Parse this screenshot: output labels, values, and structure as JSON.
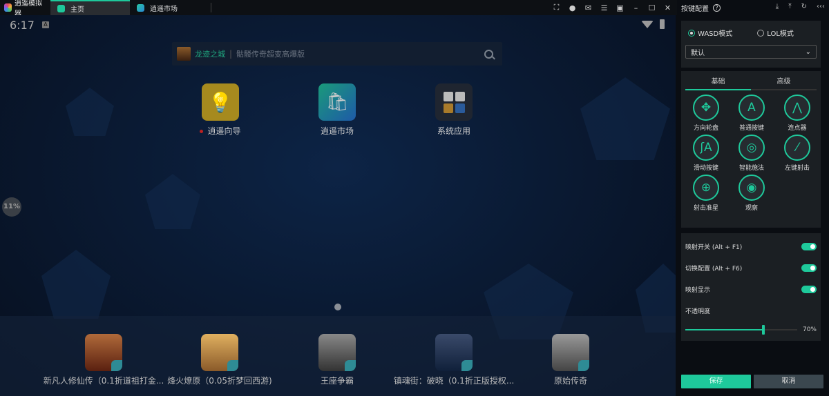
{
  "titlebar": {
    "app_name": "逍遥模拟器",
    "tabs": [
      {
        "label": "主页",
        "active": true
      },
      {
        "label": "逍遥市场",
        "active": false
      }
    ]
  },
  "android": {
    "time": "6:17",
    "status_badge": "A",
    "loading_percent": "11%",
    "search": {
      "featured": "龙迹之城",
      "hint": "骷髅传奇超变高爆版"
    },
    "apps": [
      {
        "label": "逍遥向导",
        "has_dot": true
      },
      {
        "label": "逍遥市场"
      },
      {
        "label": "系统应用"
      }
    ],
    "dock_games": [
      "新凡人修仙传（0.1折道祖打金...",
      "烽火燎原（0.05折梦回西游)",
      "王座争霸",
      "镇魂街：破晓（0.1折正版授权...",
      "原始传奇"
    ]
  },
  "panel": {
    "title": "按键配置",
    "help": "?",
    "modes": [
      {
        "label": "WASD模式",
        "selected": true
      },
      {
        "label": "LOL模式",
        "selected": false
      }
    ],
    "profile": "默认",
    "tabs": [
      {
        "label": "基础",
        "active": true
      },
      {
        "label": "高级",
        "active": false
      }
    ],
    "keys": [
      {
        "label": "方向轮盘",
        "glyph": "✥"
      },
      {
        "label": "普通按键",
        "glyph": "A"
      },
      {
        "label": "连点器",
        "glyph": "⋀"
      },
      {
        "label": "滑动按键",
        "glyph": "ʃA"
      },
      {
        "label": "智能施法",
        "glyph": "◎"
      },
      {
        "label": "左键射击",
        "glyph": "⁄"
      },
      {
        "label": "射击准星",
        "glyph": "⊕"
      },
      {
        "label": "观察",
        "glyph": "◉"
      }
    ],
    "toggles": [
      {
        "label": "映射开关 (Alt + F1)",
        "on": true
      },
      {
        "label": "切换配置 (Alt + F6)",
        "on": true
      },
      {
        "label": "映射显示",
        "on": true
      }
    ],
    "opacity_label": "不透明度",
    "opacity_value": "70%",
    "opacity_fraction": 0.7,
    "save": "保存",
    "cancel": "取消"
  },
  "colors": {
    "accent": "#1ec99b"
  }
}
